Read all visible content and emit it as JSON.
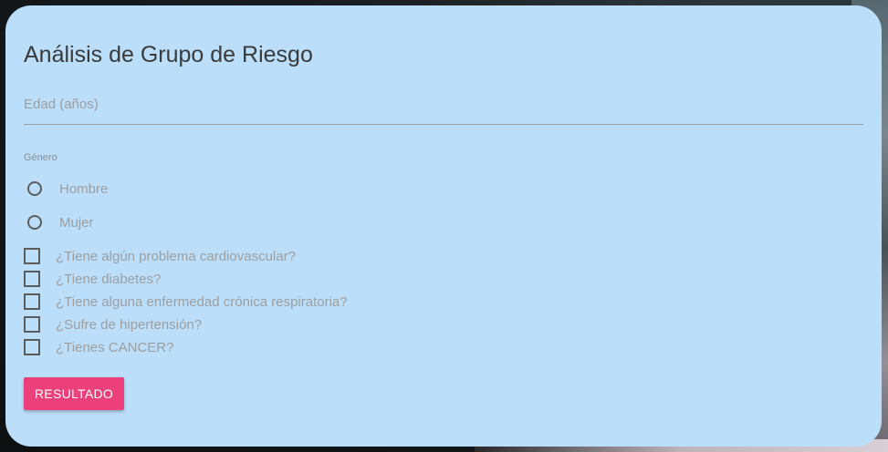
{
  "form": {
    "title": "Análisis de Grupo de Riesgo",
    "age_placeholder": "Edad (años)",
    "gender_label": "Género",
    "gender_options": [
      "Hombre",
      "Mujer"
    ],
    "questions": [
      "¿Tiene algún problema cardiovascular?",
      "¿Tiene diabetes?",
      "¿Tiene alguna enfermedad crónica respiratoria?",
      "¿Sufre de hipertensión?",
      "¿Tienes CANCER?"
    ],
    "submit_label": "RESULTADO"
  },
  "colors": {
    "card_background": "#bbdefb",
    "button_accent": "#ec407a"
  }
}
